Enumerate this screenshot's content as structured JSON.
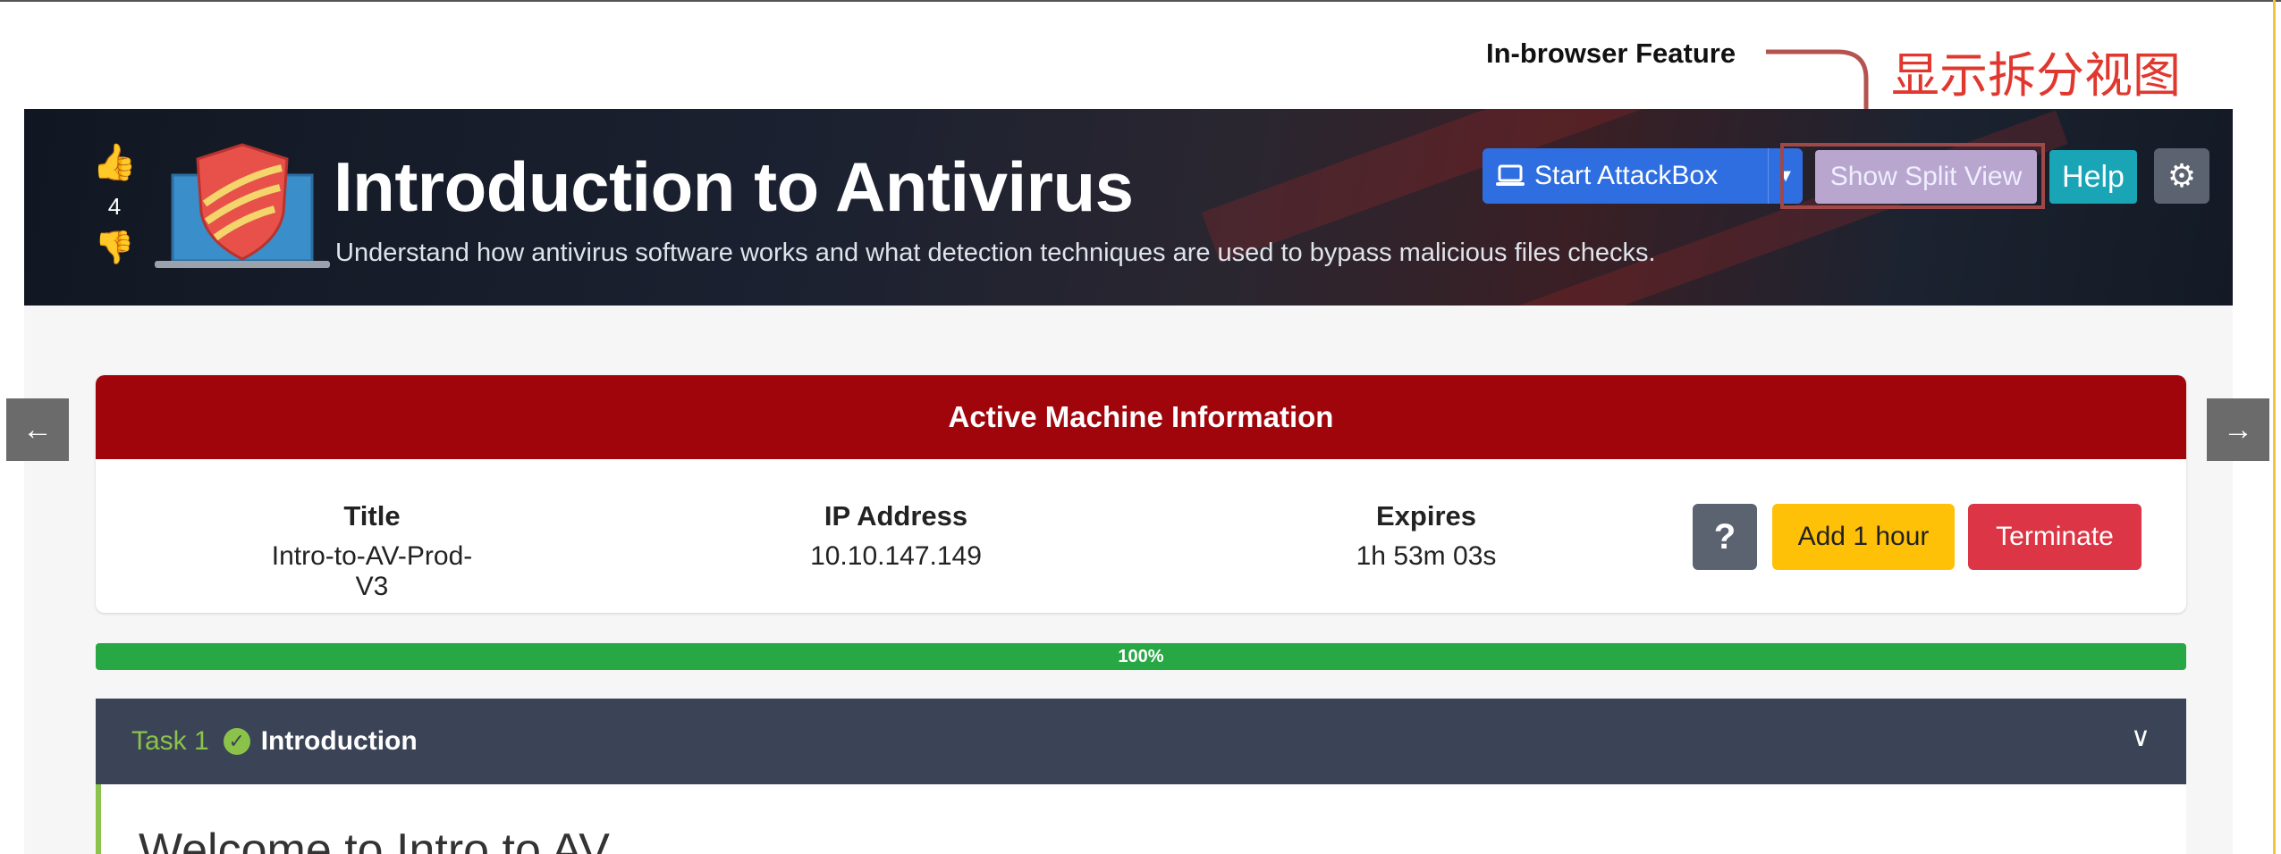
{
  "annotation": {
    "label": "In-browser Feature",
    "chinese_label": "显示拆分视图",
    "arrow_color": "#b5534f"
  },
  "room": {
    "votes": "4",
    "title": "Introduction to Antivirus",
    "description": "Understand how antivirus software works and what detection techniques are used to bypass malicious files checks.",
    "icon": "shield-laptop-icon"
  },
  "header_buttons": {
    "attackbox": "Start AttackBox",
    "split_view": "Show Split View",
    "help": "Help",
    "settings_icon": "gear-icon"
  },
  "navigation": {
    "prev": "←",
    "next": "→"
  },
  "machine": {
    "heading": "Active Machine Information",
    "title_label": "Title",
    "title_value": "Intro-to-AV-Prod-V3",
    "ip_label": "IP Address",
    "ip_value": "10.10.147.149",
    "expires_label": "Expires",
    "expires_value": "1h 53m 03s",
    "help_button": "?",
    "add_button": "Add 1 hour",
    "terminate_button": "Terminate"
  },
  "progress": {
    "label": "100%",
    "value": 100
  },
  "task": {
    "number": "Task 1",
    "name": "Introduction",
    "body_heading": "Welcome to Intro to AV"
  },
  "colors": {
    "machine_header": "#a0050c",
    "progress": "#28a745",
    "task_header": "#3b4456",
    "accent_green": "#8bc34a",
    "attackbox_blue": "#2f6ee0"
  }
}
